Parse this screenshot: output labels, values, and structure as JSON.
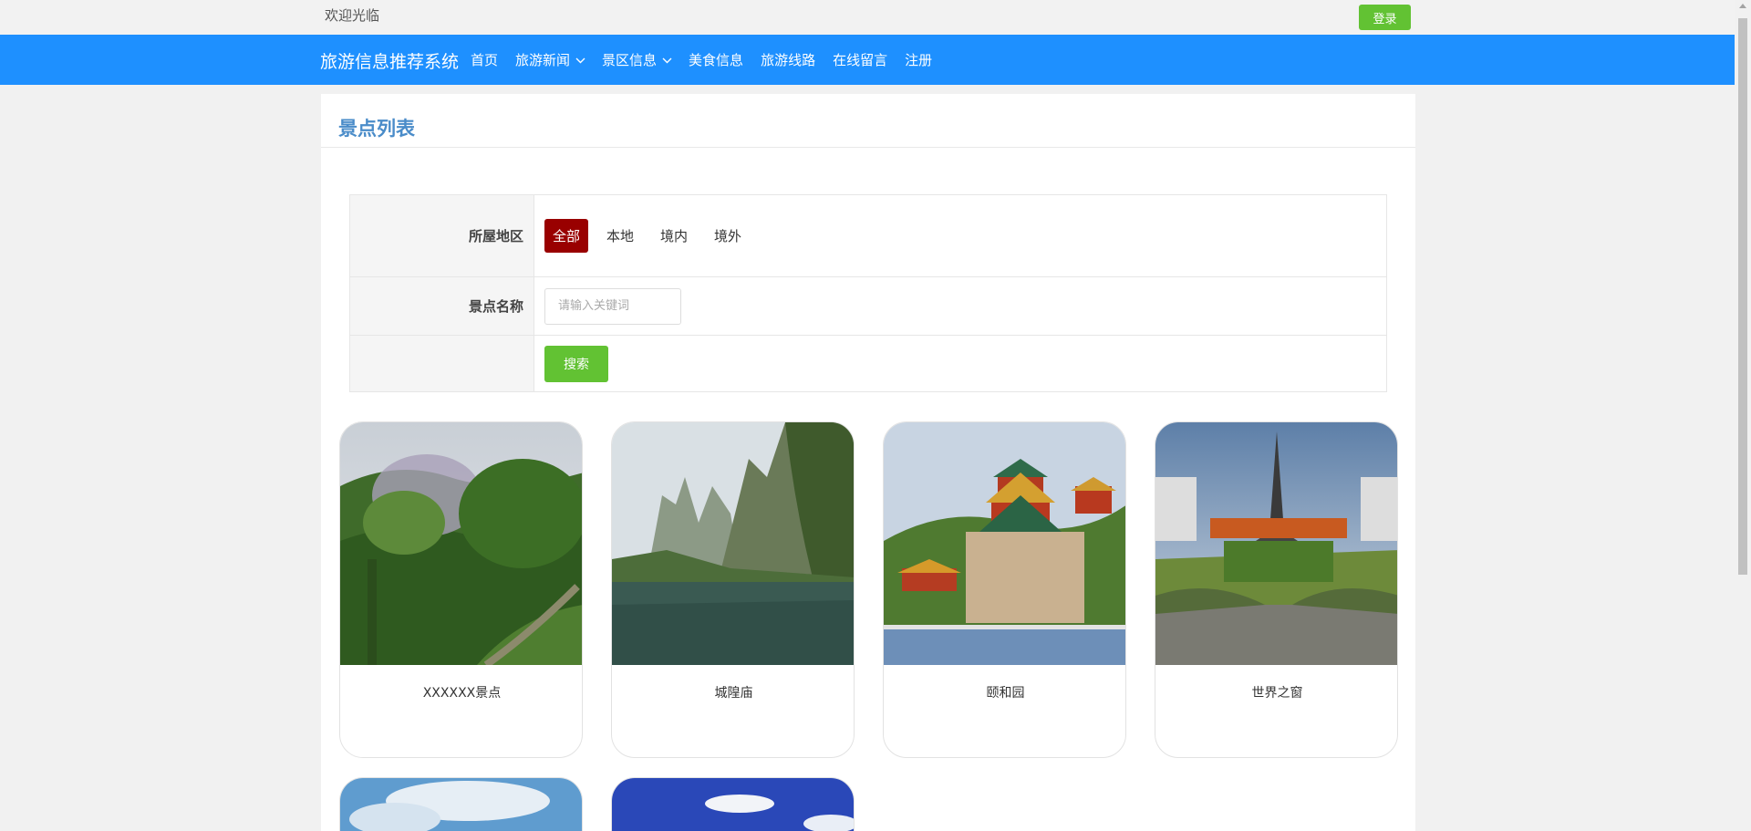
{
  "topbar": {
    "welcome": "欢迎光临",
    "login_label": "登录"
  },
  "nav": {
    "brand": "旅游信息推荐系统",
    "items": [
      {
        "label": "首页",
        "dropdown": false
      },
      {
        "label": "旅游新闻",
        "dropdown": true
      },
      {
        "label": "景区信息",
        "dropdown": true
      },
      {
        "label": "美食信息",
        "dropdown": false
      },
      {
        "label": "旅游线路",
        "dropdown": false
      },
      {
        "label": "在线留言",
        "dropdown": false
      },
      {
        "label": "注册",
        "dropdown": false
      }
    ]
  },
  "main": {
    "title": "景点列表",
    "filter": {
      "region_label": "所屋地区",
      "region_options": [
        "全部",
        "本地",
        "境内",
        "境外"
      ],
      "region_selected": "全部",
      "name_label": "景点名称",
      "name_placeholder": "请输入关键词",
      "name_value": "",
      "search_label": "搜索"
    },
    "cards": [
      {
        "name": "XXXXXX景点",
        "image": "green-forest-photo"
      },
      {
        "name": "城隍庙",
        "image": "karst-lake-photo"
      },
      {
        "name": "颐和园",
        "image": "summer-palace-photo"
      },
      {
        "name": "世界之窗",
        "image": "eiffel-tower-park-photo"
      },
      {
        "name": "",
        "image": "blue-sky-cloud-photo"
      },
      {
        "name": "",
        "image": "deep-blue-sky-photo"
      }
    ]
  },
  "colors": {
    "nav_bg": "#1e90ff",
    "accent_green": "#62c233",
    "selected_option": "#990000",
    "title_blue": "#4a8cc9"
  }
}
